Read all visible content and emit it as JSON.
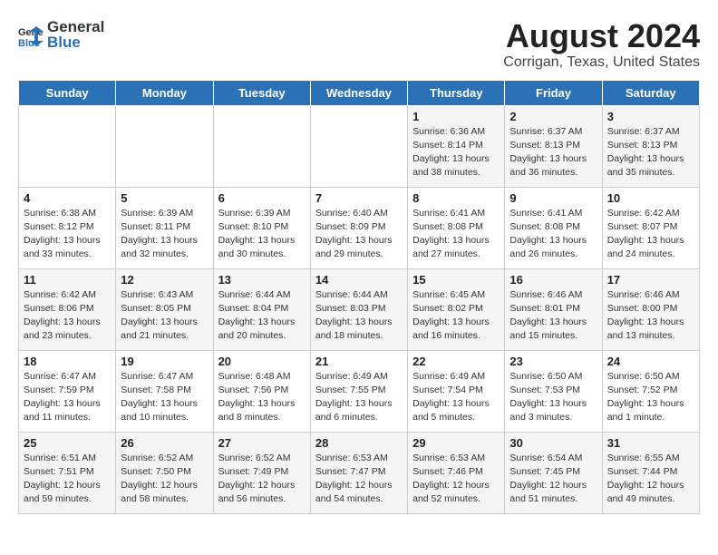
{
  "header": {
    "logo_general": "General",
    "logo_blue": "Blue",
    "main_title": "August 2024",
    "subtitle": "Corrigan, Texas, United States"
  },
  "weekdays": [
    "Sunday",
    "Monday",
    "Tuesday",
    "Wednesday",
    "Thursday",
    "Friday",
    "Saturday"
  ],
  "weeks": [
    [
      {
        "day": "",
        "info": ""
      },
      {
        "day": "",
        "info": ""
      },
      {
        "day": "",
        "info": ""
      },
      {
        "day": "",
        "info": ""
      },
      {
        "day": "1",
        "info": "Sunrise: 6:36 AM\nSunset: 8:14 PM\nDaylight: 13 hours\nand 38 minutes."
      },
      {
        "day": "2",
        "info": "Sunrise: 6:37 AM\nSunset: 8:13 PM\nDaylight: 13 hours\nand 36 minutes."
      },
      {
        "day": "3",
        "info": "Sunrise: 6:37 AM\nSunset: 8:13 PM\nDaylight: 13 hours\nand 35 minutes."
      }
    ],
    [
      {
        "day": "4",
        "info": "Sunrise: 6:38 AM\nSunset: 8:12 PM\nDaylight: 13 hours\nand 33 minutes."
      },
      {
        "day": "5",
        "info": "Sunrise: 6:39 AM\nSunset: 8:11 PM\nDaylight: 13 hours\nand 32 minutes."
      },
      {
        "day": "6",
        "info": "Sunrise: 6:39 AM\nSunset: 8:10 PM\nDaylight: 13 hours\nand 30 minutes."
      },
      {
        "day": "7",
        "info": "Sunrise: 6:40 AM\nSunset: 8:09 PM\nDaylight: 13 hours\nand 29 minutes."
      },
      {
        "day": "8",
        "info": "Sunrise: 6:41 AM\nSunset: 8:08 PM\nDaylight: 13 hours\nand 27 minutes."
      },
      {
        "day": "9",
        "info": "Sunrise: 6:41 AM\nSunset: 8:08 PM\nDaylight: 13 hours\nand 26 minutes."
      },
      {
        "day": "10",
        "info": "Sunrise: 6:42 AM\nSunset: 8:07 PM\nDaylight: 13 hours\nand 24 minutes."
      }
    ],
    [
      {
        "day": "11",
        "info": "Sunrise: 6:42 AM\nSunset: 8:06 PM\nDaylight: 13 hours\nand 23 minutes."
      },
      {
        "day": "12",
        "info": "Sunrise: 6:43 AM\nSunset: 8:05 PM\nDaylight: 13 hours\nand 21 minutes."
      },
      {
        "day": "13",
        "info": "Sunrise: 6:44 AM\nSunset: 8:04 PM\nDaylight: 13 hours\nand 20 minutes."
      },
      {
        "day": "14",
        "info": "Sunrise: 6:44 AM\nSunset: 8:03 PM\nDaylight: 13 hours\nand 18 minutes."
      },
      {
        "day": "15",
        "info": "Sunrise: 6:45 AM\nSunset: 8:02 PM\nDaylight: 13 hours\nand 16 minutes."
      },
      {
        "day": "16",
        "info": "Sunrise: 6:46 AM\nSunset: 8:01 PM\nDaylight: 13 hours\nand 15 minutes."
      },
      {
        "day": "17",
        "info": "Sunrise: 6:46 AM\nSunset: 8:00 PM\nDaylight: 13 hours\nand 13 minutes."
      }
    ],
    [
      {
        "day": "18",
        "info": "Sunrise: 6:47 AM\nSunset: 7:59 PM\nDaylight: 13 hours\nand 11 minutes."
      },
      {
        "day": "19",
        "info": "Sunrise: 6:47 AM\nSunset: 7:58 PM\nDaylight: 13 hours\nand 10 minutes."
      },
      {
        "day": "20",
        "info": "Sunrise: 6:48 AM\nSunset: 7:56 PM\nDaylight: 13 hours\nand 8 minutes."
      },
      {
        "day": "21",
        "info": "Sunrise: 6:49 AM\nSunset: 7:55 PM\nDaylight: 13 hours\nand 6 minutes."
      },
      {
        "day": "22",
        "info": "Sunrise: 6:49 AM\nSunset: 7:54 PM\nDaylight: 13 hours\nand 5 minutes."
      },
      {
        "day": "23",
        "info": "Sunrise: 6:50 AM\nSunset: 7:53 PM\nDaylight: 13 hours\nand 3 minutes."
      },
      {
        "day": "24",
        "info": "Sunrise: 6:50 AM\nSunset: 7:52 PM\nDaylight: 13 hours\nand 1 minute."
      }
    ],
    [
      {
        "day": "25",
        "info": "Sunrise: 6:51 AM\nSunset: 7:51 PM\nDaylight: 12 hours\nand 59 minutes."
      },
      {
        "day": "26",
        "info": "Sunrise: 6:52 AM\nSunset: 7:50 PM\nDaylight: 12 hours\nand 58 minutes."
      },
      {
        "day": "27",
        "info": "Sunrise: 6:52 AM\nSunset: 7:49 PM\nDaylight: 12 hours\nand 56 minutes."
      },
      {
        "day": "28",
        "info": "Sunrise: 6:53 AM\nSunset: 7:47 PM\nDaylight: 12 hours\nand 54 minutes."
      },
      {
        "day": "29",
        "info": "Sunrise: 6:53 AM\nSunset: 7:46 PM\nDaylight: 12 hours\nand 52 minutes."
      },
      {
        "day": "30",
        "info": "Sunrise: 6:54 AM\nSunset: 7:45 PM\nDaylight: 12 hours\nand 51 minutes."
      },
      {
        "day": "31",
        "info": "Sunrise: 6:55 AM\nSunset: 7:44 PM\nDaylight: 12 hours\nand 49 minutes."
      }
    ]
  ]
}
